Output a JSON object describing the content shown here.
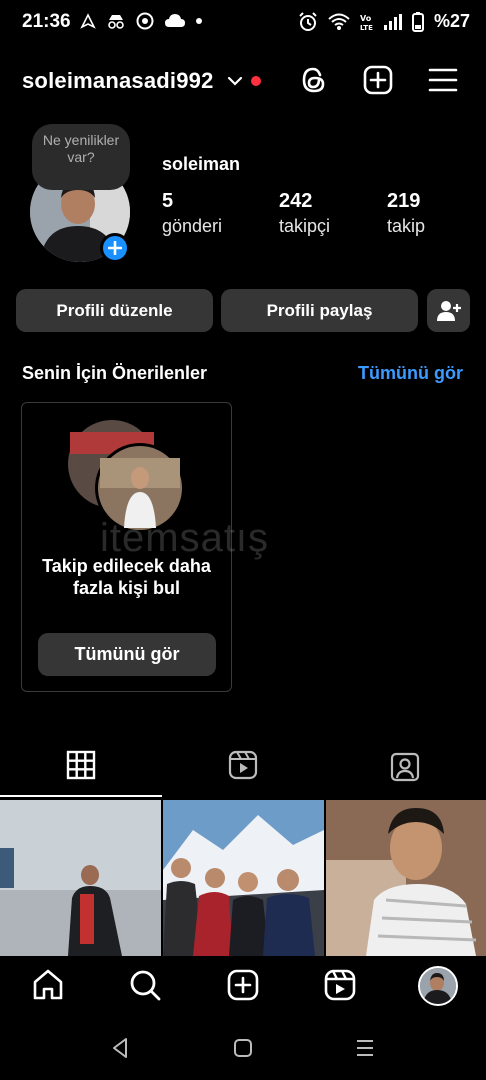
{
  "status_bar": {
    "time": "21:36",
    "battery": "%27",
    "icons": [
      "navigation-icon",
      "incognito-icon",
      "chrome-icon",
      "cloud-icon",
      "dot-icon",
      "alarm-icon",
      "wifi-icon",
      "volte-icon",
      "signal-icon",
      "battery-icon"
    ]
  },
  "header": {
    "username": "soleimanasadi992",
    "icons": [
      "chevron-down-icon",
      "threads-icon",
      "create-post-icon",
      "menu-icon"
    ],
    "notification_dot_color": "#ff3040"
  },
  "profile": {
    "note": "Ne yenilikler var?",
    "display_name": "soleiman",
    "stats": [
      {
        "value": "5",
        "label": "gönderi"
      },
      {
        "value": "242",
        "label": "takipçi"
      },
      {
        "value": "219",
        "label": "takip"
      }
    ]
  },
  "actions": {
    "edit_profile": "Profili düzenle",
    "share_profile": "Profili paylaş",
    "add_person_icon": "add-person-icon"
  },
  "suggestions": {
    "title": "Senin İçin Önerilenler",
    "see_all": "Tümünü gör",
    "card_text": "Takip edilecek daha fazla kişi bul",
    "card_button": "Tümünü gör"
  },
  "watermark": "itemsatış",
  "tabs": [
    "grid-icon",
    "reels-icon",
    "tagged-icon"
  ],
  "bottom_nav": [
    "home-icon",
    "search-icon",
    "create-icon",
    "reels-icon",
    "profile-avatar"
  ],
  "system_nav": [
    "back-icon",
    "home-icon",
    "recents-icon"
  ],
  "colors": {
    "background": "#000000",
    "button": "#363636",
    "link": "#3d9aff",
    "badge": "#1a90ff"
  }
}
